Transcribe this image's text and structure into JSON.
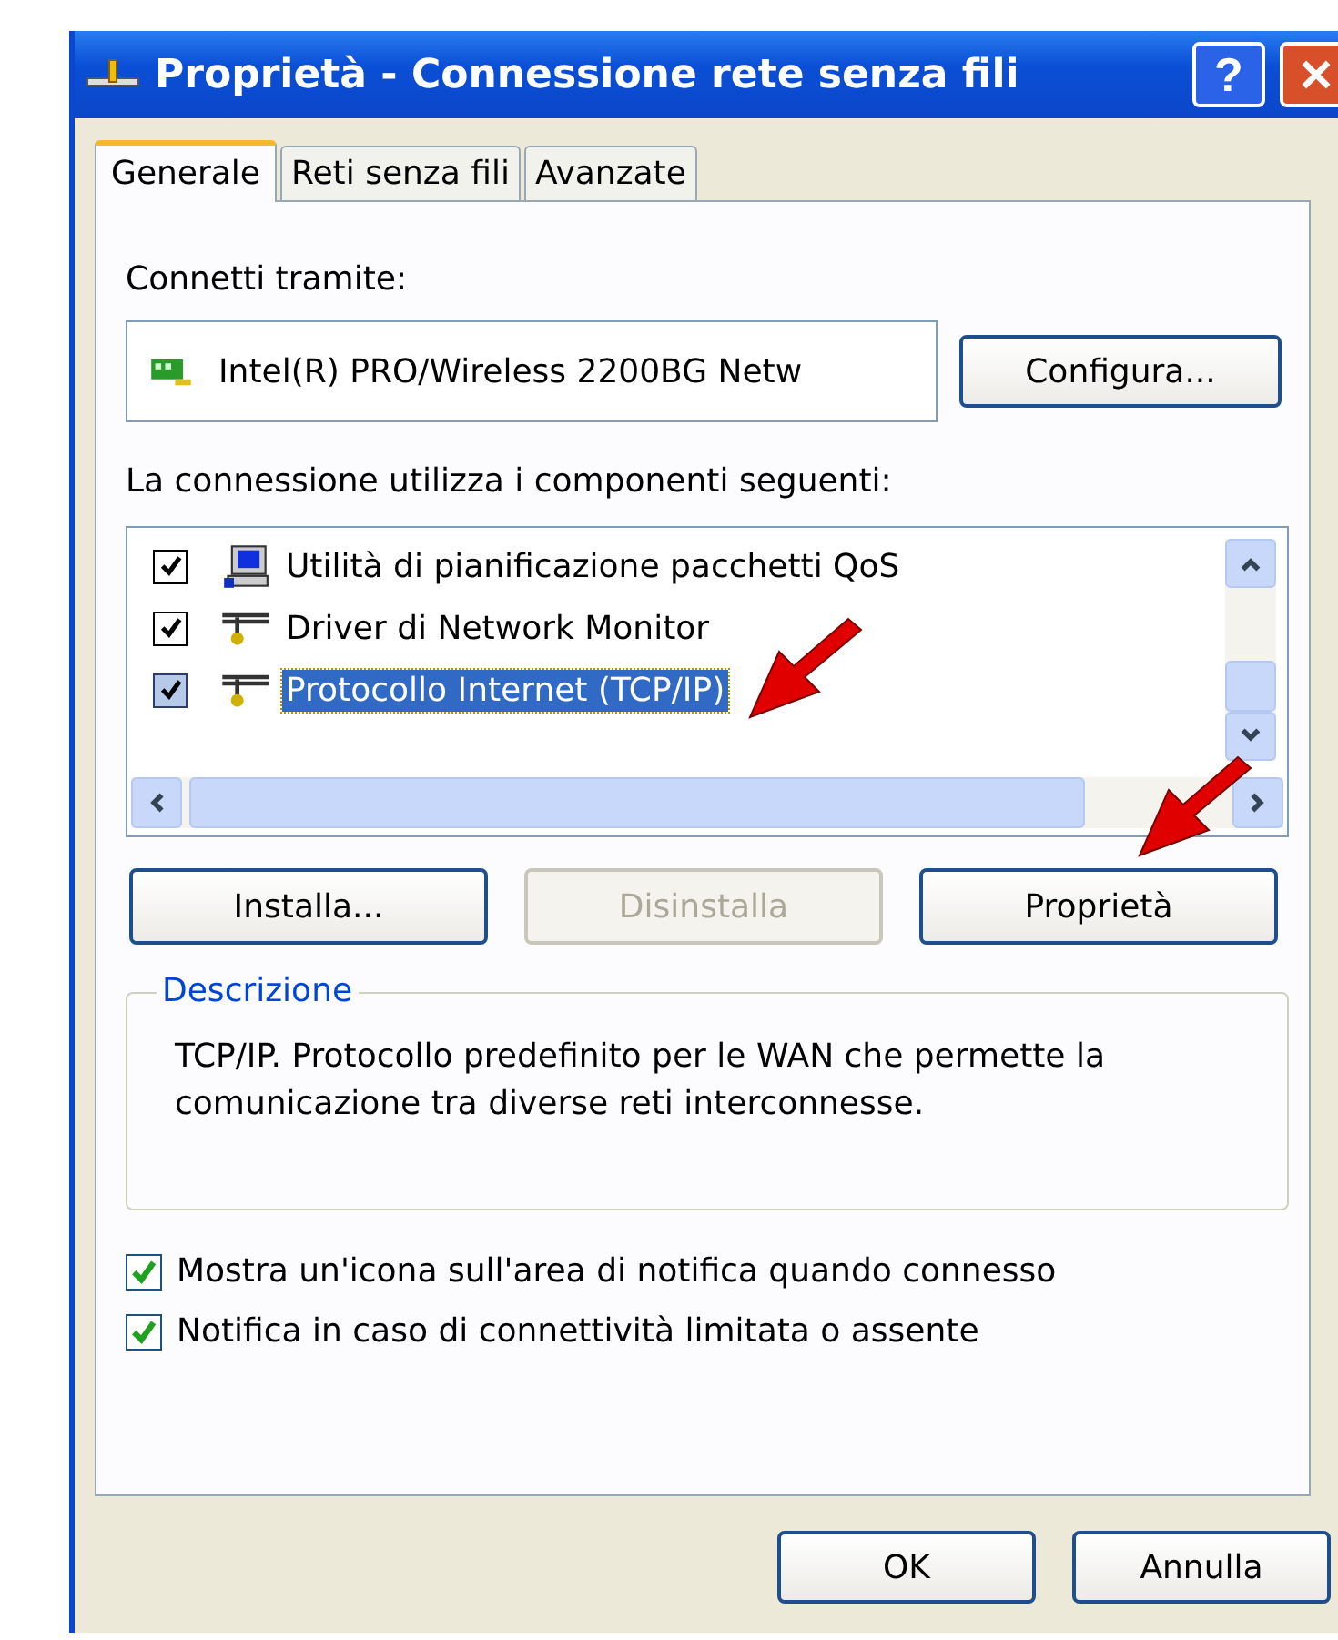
{
  "window": {
    "title": "Proprietà - Connessione rete senza fili",
    "help_button": "?"
  },
  "tabs": [
    {
      "label": "Generale",
      "selected": true
    },
    {
      "label": "Reti senza fili",
      "selected": false
    },
    {
      "label": "Avanzate",
      "selected": false
    }
  ],
  "connect_via": {
    "label": "Connetti tramite:",
    "adapter": "Intel(R) PRO/Wireless 2200BG Netw",
    "configure_button": "Configura..."
  },
  "components": {
    "label": "La connessione utilizza i componenti seguenti:",
    "items": [
      {
        "kind": "scheduler",
        "label": "Utilità di pianificazione pacchetti QoS",
        "checked": true,
        "selected": false
      },
      {
        "kind": "protocol",
        "label": "Driver di Network Monitor",
        "checked": true,
        "selected": false
      },
      {
        "kind": "protocol",
        "label": "Protocollo Internet (TCP/IP)",
        "checked": true,
        "selected": true
      }
    ]
  },
  "component_buttons": [
    {
      "label": "Installa...",
      "disabled": false
    },
    {
      "label": "Disinstalla",
      "disabled": true
    },
    {
      "label": "Proprietà",
      "disabled": false
    }
  ],
  "description": {
    "title": "Descrizione",
    "text": "TCP/IP. Protocollo predefinito per le WAN che permette la comunicazione tra diverse reti interconnesse."
  },
  "options": [
    {
      "label": "Mostra un'icona sull'area di notifica quando connesso",
      "checked": true
    },
    {
      "label": "Notifica in caso di connettività limitata o assente",
      "checked": true
    }
  ],
  "dialog_buttons": [
    "OK",
    "Annulla"
  ]
}
